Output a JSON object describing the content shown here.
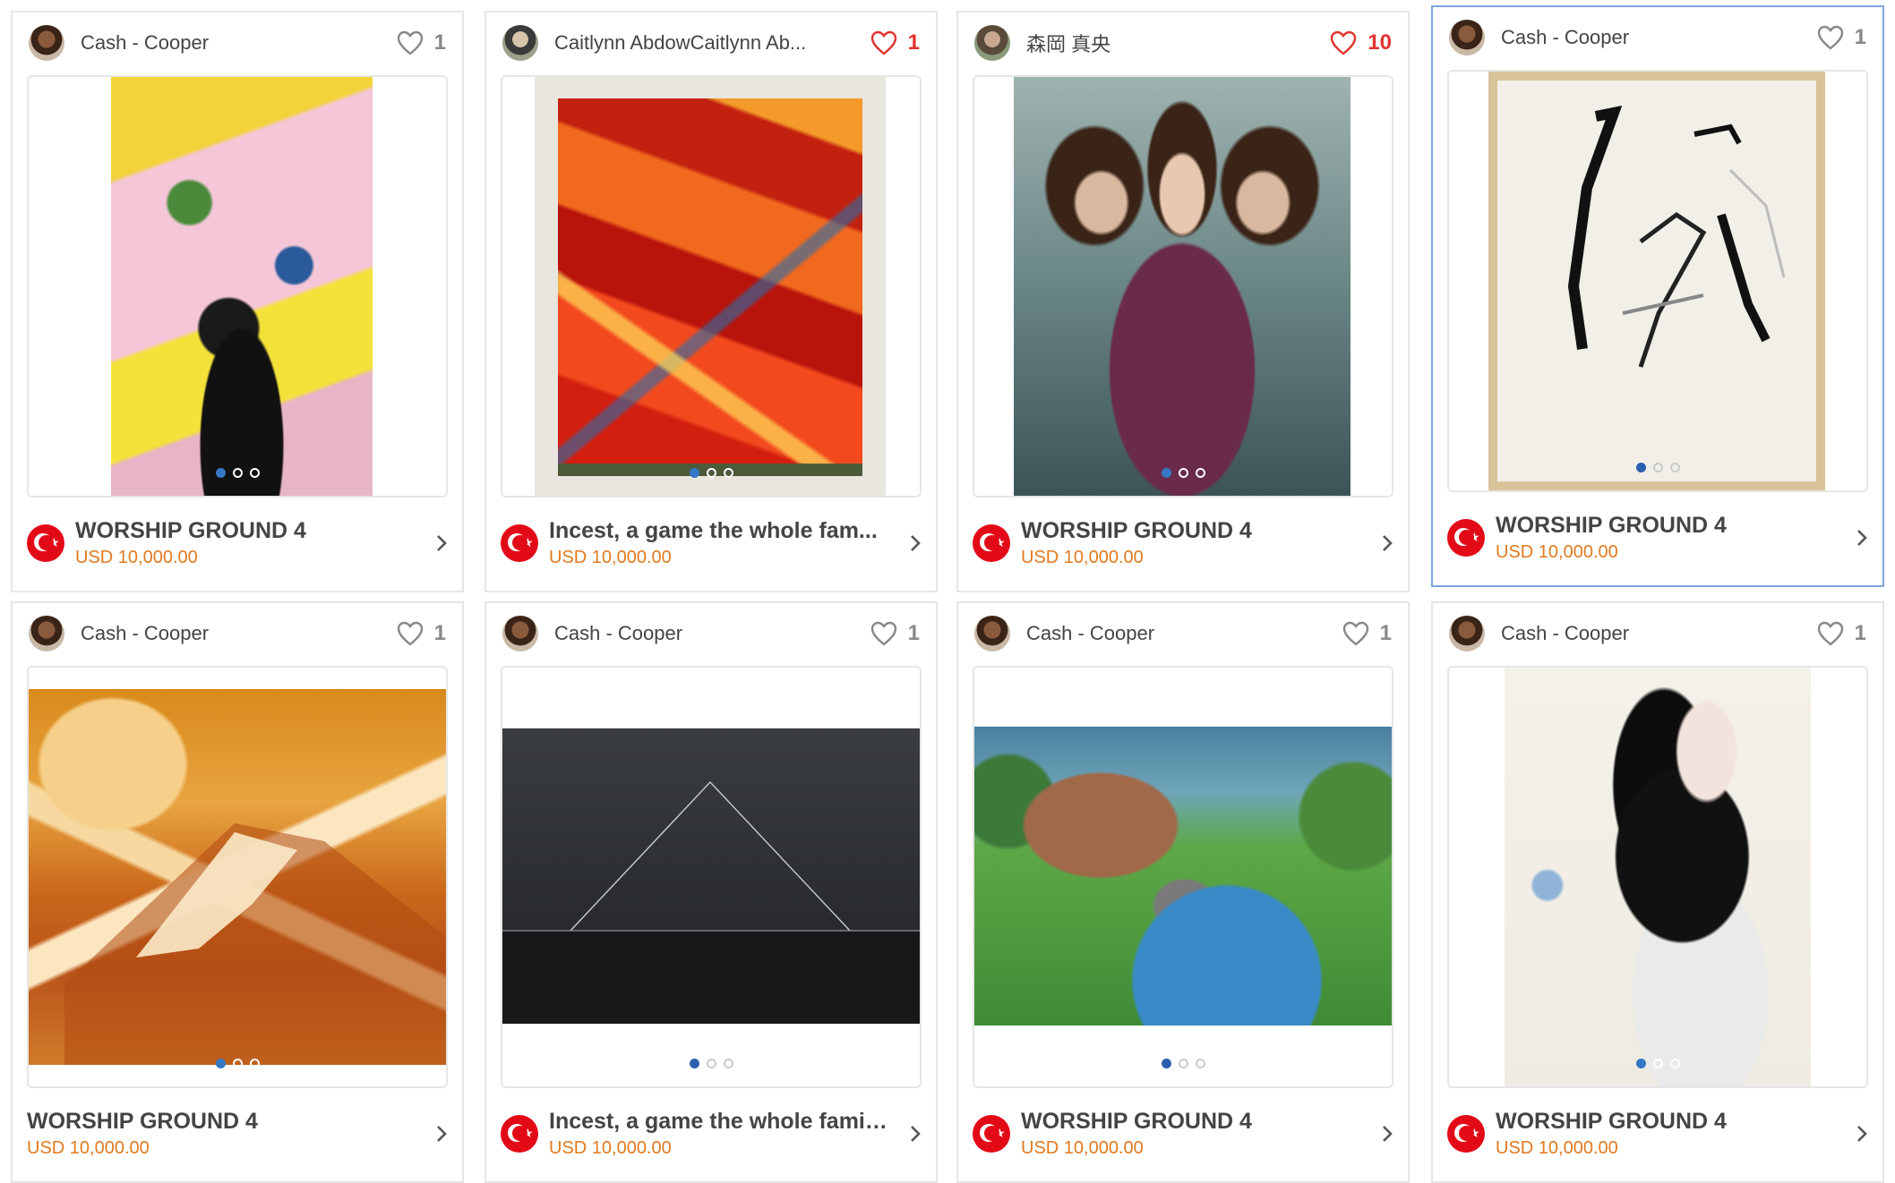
{
  "currency_flag": "turkey-flag",
  "cards": [
    {
      "author": "Cash - Cooper",
      "likes": "1",
      "liked": false,
      "title": "WORSHIP GROUND 4",
      "price": "USD 10,000.00",
      "flag": true
    },
    {
      "author": "Caitlynn AbdowCaitlynn Ab...",
      "likes": "1",
      "liked": true,
      "title": "Incest, a game the whole fam...",
      "price": "USD 10,000.00",
      "flag": true
    },
    {
      "author": "森岡 真央",
      "likes": "10",
      "liked": true,
      "title": "WORSHIP GROUND 4",
      "price": "USD 10,000.00",
      "flag": true
    },
    {
      "author": "Cash - Cooper",
      "likes": "1",
      "liked": false,
      "title": "WORSHIP GROUND 4",
      "price": "USD 10,000.00",
      "flag": true,
      "selected": true
    },
    {
      "author": "Cash - Cooper",
      "likes": "1",
      "liked": false,
      "title": "WORSHIP GROUND 4",
      "price": "USD 10,000.00",
      "flag": false
    },
    {
      "author": "Cash - Cooper",
      "likes": "1",
      "liked": false,
      "title": "Incest, a game the whole famil...",
      "price": "USD 10,000.00",
      "flag": true
    },
    {
      "author": "Cash - Cooper",
      "likes": "1",
      "liked": false,
      "title": "WORSHIP GROUND 4",
      "price": "USD 10,000.00",
      "flag": true
    },
    {
      "author": "Cash - Cooper",
      "likes": "1",
      "liked": false,
      "title": "WORSHIP GROUND 4",
      "price": "USD 10,000.00",
      "flag": true
    }
  ]
}
